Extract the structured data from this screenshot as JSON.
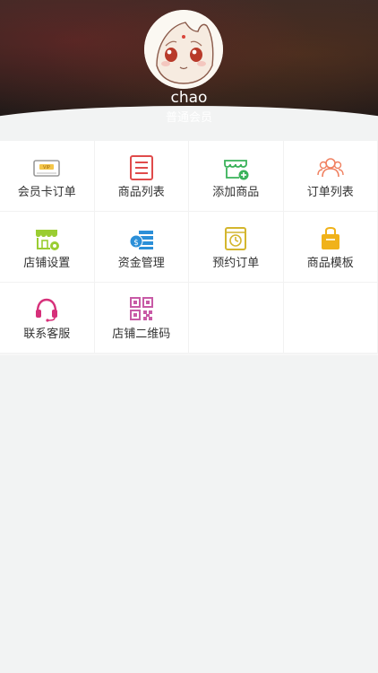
{
  "profile": {
    "username": "chao",
    "member_level": "普通会员"
  },
  "menu": [
    {
      "label": "会员卡订单",
      "icon": "vip-card-icon",
      "color": "#e8a23a"
    },
    {
      "label": "商品列表",
      "icon": "product-list-icon",
      "color": "#e04b4b"
    },
    {
      "label": "添加商品",
      "icon": "add-product-icon",
      "color": "#3ab25a"
    },
    {
      "label": "订单列表",
      "icon": "users-icon",
      "color": "#f08060"
    },
    {
      "label": "店铺设置",
      "icon": "shop-settings-icon",
      "color": "#7cc23a"
    },
    {
      "label": "资金管理",
      "icon": "fund-icon",
      "color": "#2b8fd8"
    },
    {
      "label": "预约订单",
      "icon": "appointment-icon",
      "color": "#d4b62e"
    },
    {
      "label": "商品模板",
      "icon": "template-icon",
      "color": "#f0b21a"
    },
    {
      "label": "联系客服",
      "icon": "headset-icon",
      "color": "#d6307a"
    },
    {
      "label": "店铺二维码",
      "icon": "qrcode-icon",
      "color": "#c85aa6"
    }
  ]
}
